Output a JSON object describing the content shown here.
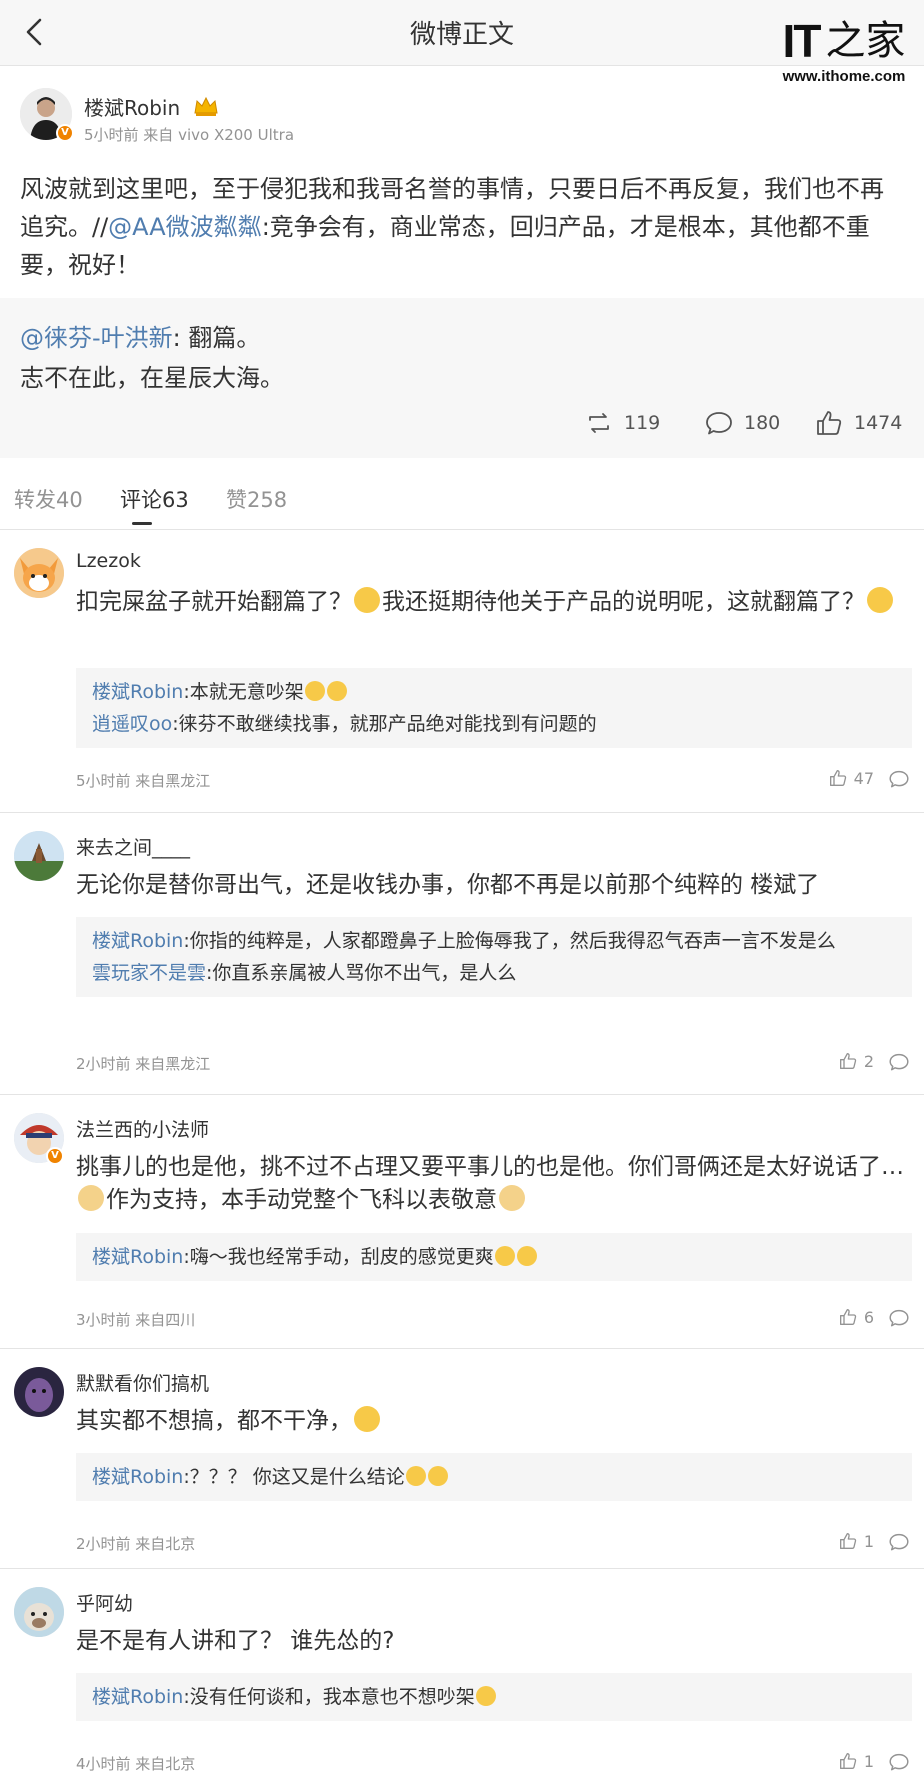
{
  "header": {
    "title": "微博正文"
  },
  "watermark": {
    "logo_it": "IT",
    "logo_cn": "之家",
    "url": "www.ithome.com"
  },
  "post": {
    "author": "楼斌Robin",
    "meta": "5小时前  来自 vivo X200 Ultra",
    "text_main": "风波就到这里吧，至于侵犯我和我哥名誉的事情，只要日后不再反复，我们也不再追究。//",
    "text_mention": "@AA微波粼粼",
    "text_rest": ":竞争会有，商业常态，回归产品，才是根本，其他都不重要，祝好！",
    "quote_mention": "@徕芬-叶洪新",
    "quote_text1": ": 翻篇。",
    "quote_text2": "志不在此，在星辰大海。",
    "reposts": "119",
    "comments": "180",
    "likes": "1474"
  },
  "tabs": [
    {
      "label": "转发40"
    },
    {
      "label": "评论63"
    },
    {
      "label": "赞258"
    }
  ],
  "comments": [
    {
      "name": "Lzezok",
      "text_a": "扣完屎盆子就开始翻篇了？",
      "text_b": "我还挺期待他关于产品的说明呢，这就翻篇了？",
      "replies": [
        {
          "name": "楼斌Robin",
          "text": ":本就无意吵架"
        },
        {
          "name": "逍遥叹oo",
          "text": ":徕芬不敢继续找事，就那产品绝对能找到有问题的"
        }
      ],
      "meta": "5小时前  来自黑龙江",
      "likes": "47"
    },
    {
      "name": "来去之间____",
      "text": "无论你是替你哥出气，还是收钱办事，你都不再是以前那个纯粹的 楼斌了",
      "replies": [
        {
          "name": "楼斌Robin",
          "text": ":你指的纯粹是，人家都蹬鼻子上脸侮辱我了，然后我得忍气吞声一言不发是么"
        },
        {
          "name": "雲玩家不是雲",
          "text": ":你直系亲属被人骂你不出气，是人么"
        }
      ],
      "meta": "2小时前  来自黑龙江",
      "likes": "2"
    },
    {
      "name": "法兰西的小法师",
      "text_a": "挑事儿的也是他，挑不过不占理又要平事儿的也是他。你们哥俩还是太好说话了…",
      "text_b": "作为支持，本手动党整个飞科以表敬意",
      "replies": [
        {
          "name": "楼斌Robin",
          "text": ":嗨～我也经常手动，刮皮的感觉更爽"
        }
      ],
      "meta": "3小时前  来自四川",
      "likes": "6"
    },
    {
      "name": "默默看你们搞机",
      "text": "其实都不想搞，都不干净，",
      "replies": [
        {
          "name": "楼斌Robin",
          "text": ":？？？ 你这又是什么结论"
        }
      ],
      "meta": "2小时前  来自北京",
      "likes": "1"
    },
    {
      "name": "乎阿幼",
      "text": "是不是有人讲和了？ 谁先怂的?",
      "replies": [
        {
          "name": "楼斌Robin",
          "text": ":没有任何谈和，我本意也不想吵架"
        }
      ],
      "meta": "4小时前  来自北京",
      "likes": "1"
    }
  ],
  "colors": {
    "link": "#507daf",
    "meta": "#939393",
    "bg_gray": "#f5f5f5",
    "badge": "#f08300"
  },
  "icons": [
    "back-arrow-icon",
    "repost-icon",
    "comment-icon",
    "like-icon",
    "reply-icon",
    "verified-badge-icon",
    "crown-icon"
  ]
}
